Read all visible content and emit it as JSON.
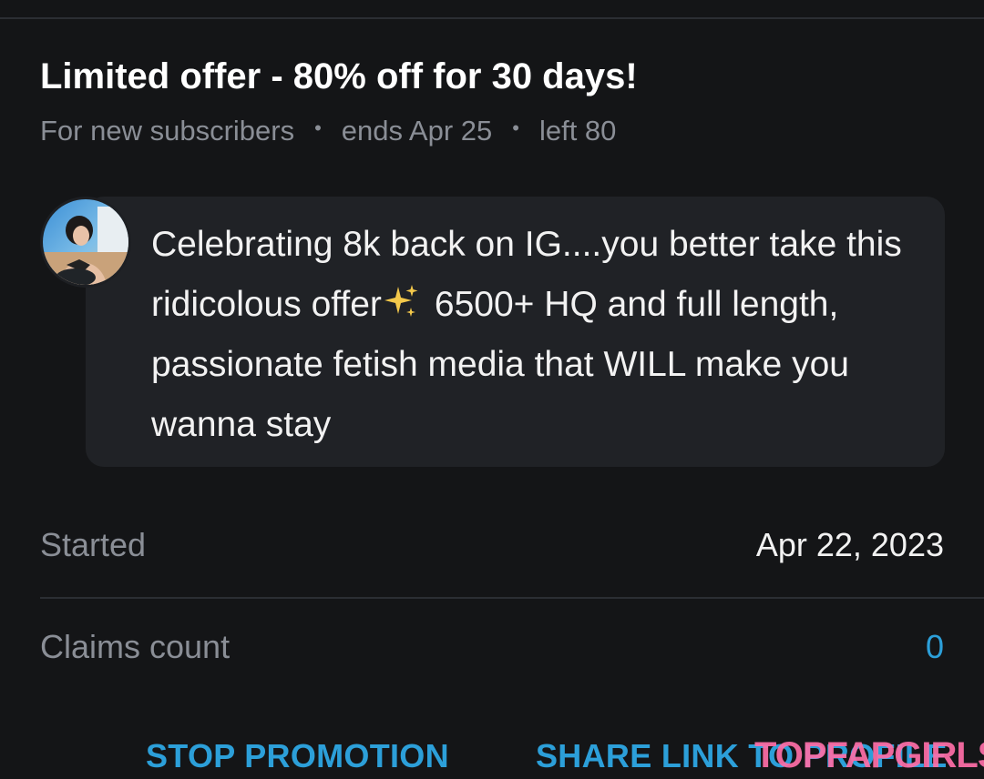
{
  "offer": {
    "title": "Limited offer - 80% off for 30 days!",
    "audience": "For new subscribers",
    "separator": "•",
    "ends": "ends Apr 25",
    "left": "left 80"
  },
  "message": {
    "line_part1": "Celebrating 8k back on IG....you better take this ridicolous offer",
    "emoji": "sparkles-icon",
    "line_part2": "6500+ HQ and full length, passionate fetish media that WILL make you wanna stay"
  },
  "details": {
    "started_label": "Started",
    "started_value": "Apr 22, 2023",
    "claims_label": "Claims count",
    "claims_value": "0"
  },
  "actions": {
    "stop_label": "STOP PROMOTION",
    "share_label": "SHARE LINK TO PROFILE"
  },
  "watermark": {
    "text": "TOPFAPGIRLS"
  },
  "colors": {
    "background": "#141517",
    "bubble": "#202226",
    "muted_text": "#8a8e96",
    "accent_link": "#2c9fd9",
    "watermark": "#ff6ea8"
  }
}
